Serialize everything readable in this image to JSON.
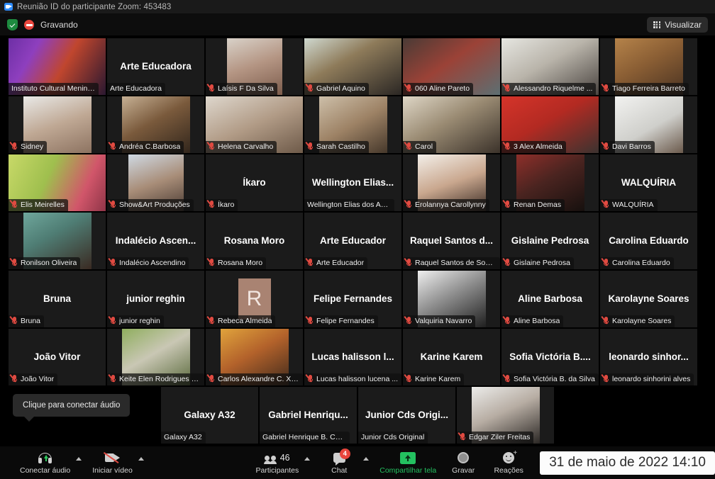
{
  "window": {
    "title": "Reunião ID do participante Zoom: 453483",
    "logo_icon": "zoom-logo-icon"
  },
  "status": {
    "encryption_icon": "shield-check-icon",
    "recording_icon": "recording-dot-icon",
    "recording_label": "Gravando",
    "view_button": {
      "label": "Visualizar",
      "icon": "grid-view-icon"
    }
  },
  "tooltip": {
    "text": "Clique para conectar áudio"
  },
  "gallery": {
    "rows": [
      [
        {
          "name": "Instituto Cultural Menino ...",
          "display": "",
          "muted": false,
          "active": true,
          "video": "purple-studio",
          "thumb": "full"
        },
        {
          "name": "Arte Educadora",
          "display": "Arte Educadora",
          "muted": false,
          "active": false,
          "video": "none",
          "thumb": "none"
        },
        {
          "name": "Laísis F Da Silva",
          "display": "",
          "muted": true,
          "active": false,
          "video": "woman-glasses-white-wall",
          "thumb": "narrow"
        },
        {
          "name": "Gabriel Aquino",
          "display": "",
          "muted": true,
          "active": false,
          "video": "man-curly-hair-desk",
          "thumb": "full"
        },
        {
          "name": "060 Aline Pareto",
          "display": "",
          "muted": true,
          "active": false,
          "video": "woman-red-scarf",
          "thumb": "full"
        },
        {
          "name": "Alessandro Riquelme ...",
          "display": "",
          "muted": true,
          "active": false,
          "video": "man-glasses-headset",
          "thumb": "full"
        },
        {
          "name": "Tiago Ferreira Barreto",
          "display": "",
          "muted": true,
          "active": false,
          "video": "man-wood-wall",
          "thumb": "mid"
        }
      ],
      [
        {
          "name": "Sidney",
          "display": "",
          "muted": true,
          "active": false,
          "video": "bald-man-white-shirt",
          "thumb": "mid"
        },
        {
          "name": "Andréa C.Barbosa",
          "display": "",
          "muted": true,
          "active": false,
          "video": "woman-blue-glasses",
          "thumb": "mid"
        },
        {
          "name": "Helena Carvalho",
          "display": "",
          "muted": true,
          "active": false,
          "video": "woman-blonde-glasses",
          "thumb": "full"
        },
        {
          "name": "Sarah Castilho",
          "display": "",
          "muted": true,
          "active": false,
          "video": "young-woman-indoor",
          "thumb": "mid"
        },
        {
          "name": "Carol",
          "display": "",
          "muted": true,
          "active": false,
          "video": "woman-hat-wall",
          "thumb": "full"
        },
        {
          "name": "3 Alex Almeida",
          "display": "",
          "muted": true,
          "active": false,
          "video": "man-red-background",
          "thumb": "full"
        },
        {
          "name": "Davi Barros",
          "display": "",
          "muted": true,
          "active": false,
          "video": "man-white-room",
          "thumb": "mid"
        }
      ],
      [
        {
          "name": "Elis Meirelles",
          "display": "",
          "muted": true,
          "active": false,
          "video": "green-pink-blur",
          "thumb": "full"
        },
        {
          "name": "Show&Art Produções",
          "display": "",
          "muted": true,
          "active": false,
          "video": "smiling-woman",
          "thumb": "narrow"
        },
        {
          "name": "Íkaro",
          "display": "Íkaro",
          "muted": true,
          "active": false,
          "video": "none",
          "thumb": "none"
        },
        {
          "name": "Wellington Elias dos Anjos",
          "display": "Wellington  Elias...",
          "muted": false,
          "active": false,
          "video": "none",
          "thumb": "none"
        },
        {
          "name": "Erolannya Carollynny",
          "display": "",
          "muted": true,
          "active": false,
          "video": "smiling-woman-white",
          "thumb": "mid"
        },
        {
          "name": "Renan Demas",
          "display": "",
          "muted": true,
          "active": false,
          "video": "man-mirror-selfie",
          "thumb": "mid"
        },
        {
          "name": "WALQUÍRIA",
          "display": "WALQUÍRIA",
          "muted": true,
          "active": false,
          "video": "none",
          "thumb": "none"
        }
      ],
      [
        {
          "name": "Ronilson Oliveira",
          "display": "",
          "muted": true,
          "active": false,
          "video": "man-teal-background",
          "thumb": "mid"
        },
        {
          "name": "Indalécio Ascendino",
          "display": "Indalécio  Ascen...",
          "muted": true,
          "active": false,
          "video": "none",
          "thumb": "none"
        },
        {
          "name": "Rosana Moro",
          "display": "Rosana Moro",
          "muted": true,
          "active": false,
          "video": "none",
          "thumb": "none"
        },
        {
          "name": "Arte Educador",
          "display": "Arte Educador",
          "muted": true,
          "active": false,
          "video": "none",
          "thumb": "none"
        },
        {
          "name": "Raquel Santos de Souz...",
          "display": "Raquel  Santos  d...",
          "muted": true,
          "active": false,
          "video": "none",
          "thumb": "none"
        },
        {
          "name": "Gislaine Pedrosa",
          "display": "Gislaine Pedrosa",
          "muted": true,
          "active": false,
          "video": "none",
          "thumb": "none"
        },
        {
          "name": "Carolina Eduardo",
          "display": "Carolina Eduardo",
          "muted": true,
          "active": false,
          "video": "none",
          "thumb": "none"
        }
      ],
      [
        {
          "name": "Bruna",
          "display": "Bruna",
          "muted": true,
          "active": false,
          "video": "none",
          "thumb": "none"
        },
        {
          "name": "junior reghin",
          "display": "junior reghin",
          "muted": true,
          "active": false,
          "video": "none",
          "thumb": "none"
        },
        {
          "name": "Rebeca Almeida",
          "display": "",
          "muted": true,
          "active": false,
          "video": "avatar",
          "thumb": "avatar",
          "avatar_letter": "R",
          "avatar_color": "#a98372"
        },
        {
          "name": "Felipe Fernandes",
          "display": "Felipe Fernandes",
          "muted": true,
          "active": false,
          "video": "none",
          "thumb": "none"
        },
        {
          "name": "Valquiria Navarro",
          "display": "",
          "muted": true,
          "active": false,
          "video": "bw-woman-photo",
          "thumb": "mid"
        },
        {
          "name": "Aline Barbosa",
          "display": "Aline Barbosa",
          "muted": true,
          "active": false,
          "video": "none",
          "thumb": "none"
        },
        {
          "name": "Karolayne Soares",
          "display": "Karolayne Soares",
          "muted": true,
          "active": false,
          "video": "none",
          "thumb": "none"
        }
      ],
      [
        {
          "name": "João Vitor",
          "display": "João Vitor",
          "muted": true,
          "active": false,
          "video": "none",
          "thumb": "none"
        },
        {
          "name": "Keite Elen Rodrigues S...",
          "display": "",
          "muted": true,
          "active": false,
          "video": "woman-outdoor-park",
          "thumb": "mid"
        },
        {
          "name": "Carlos Alexandre C. Xa...",
          "display": "",
          "muted": true,
          "active": false,
          "video": "man-sunset-beach",
          "thumb": "mid"
        },
        {
          "name": "Lucas halisson lucena ...",
          "display": "Lucas halisson  l...",
          "muted": true,
          "active": false,
          "video": "none",
          "thumb": "none"
        },
        {
          "name": "Karine Karem",
          "display": "Karine Karem",
          "muted": true,
          "active": false,
          "video": "none",
          "thumb": "none"
        },
        {
          "name": "Sofia Victória B. da Silva",
          "display": "Sofia Victória B....",
          "muted": true,
          "active": false,
          "video": "none",
          "thumb": "none"
        },
        {
          "name": "leonardo sinhorini alves",
          "display": "leonardo  sinhor...",
          "muted": true,
          "active": false,
          "video": "none",
          "thumb": "none"
        }
      ],
      [
        {
          "name": "Galaxy A32",
          "display": "Galaxy A32",
          "muted": false,
          "active": false,
          "video": "none",
          "thumb": "none"
        },
        {
          "name": "Gabriel Henrique B. Cabral",
          "display": "Gabriel Henriqu...",
          "muted": false,
          "active": false,
          "video": "none",
          "thumb": "none"
        },
        {
          "name": "Junior Cds Original",
          "display": "Junior Cds Origi...",
          "muted": false,
          "active": false,
          "video": "none",
          "thumb": "none"
        },
        {
          "name": "Edgar Ziler Freitas",
          "display": "",
          "muted": true,
          "active": false,
          "video": "man-long-hair-glasses",
          "thumb": "mid"
        }
      ]
    ]
  },
  "toolbar": {
    "audio": {
      "label": "Conectar áudio",
      "icon": "headset-connect-audio-icon"
    },
    "video": {
      "label": "Iniciar vídeo",
      "icon": "camera-off-icon"
    },
    "participants": {
      "label": "Participantes",
      "count": "46",
      "icon": "participants-icon"
    },
    "chat": {
      "label": "Chat",
      "badge": "4",
      "icon": "chat-bubble-icon"
    },
    "share": {
      "label": "Compartilhar tela",
      "icon": "share-screen-icon"
    },
    "record": {
      "label": "Gravar",
      "icon": "record-circle-icon"
    },
    "reactions": {
      "label": "Reações",
      "icon": "smiley-reactions-icon"
    },
    "clock": "31 de maio de 2022 14:10"
  },
  "colors": {
    "accent_green": "#24c160",
    "mute_red": "#e04a41",
    "active_border": "#d9f36b",
    "zoom_blue": "#2d8cff",
    "badge_red": "#e8453c"
  }
}
